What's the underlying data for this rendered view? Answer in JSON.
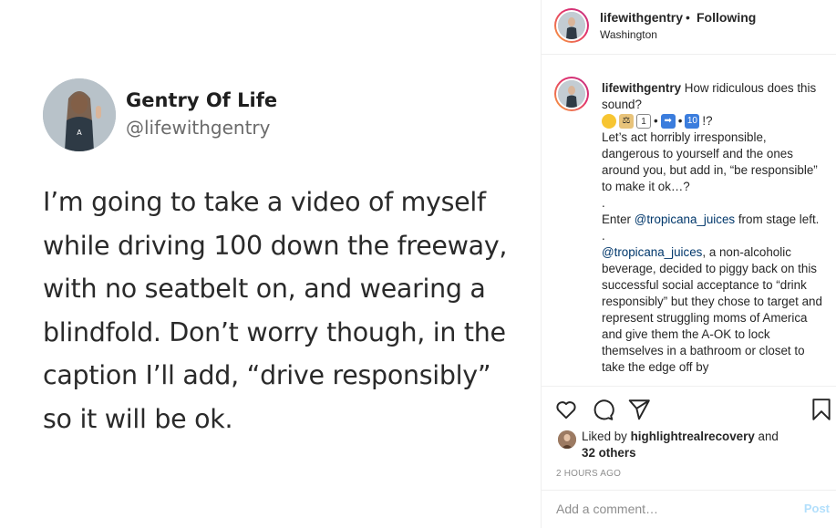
{
  "tweet": {
    "display_name": "Gentry Of Life",
    "handle": "@lifewithgentry",
    "text": "I’m going to take a video of myself while driving 100 down the freeway, with no seatbelt on, and wearing a blindfold. Don’t worry though, in the caption I’ll add, “drive responsibly” so it will be ok."
  },
  "post_header": {
    "username": "lifewithgentry",
    "separator": "•",
    "follow_status": "Following",
    "location": "Washington"
  },
  "caption": {
    "username": "lifewithgentry",
    "line1": "How ridiculous does this sound?",
    "emoji_tail": "!?",
    "para1": "Let’s act horribly irresponsible, dangerous to yourself and the ones around you, but add in, “be responsible” to make it ok…?",
    "dot1": ".",
    "para2_prefix": "Enter ",
    "para2_mention": "@tropicana_juices",
    "para2_suffix": " from stage left.",
    "dot2": ".",
    "para3_mention": "@tropicana_juices",
    "para3_text": ", a non-alcoholic beverage, decided to piggy back on this successful social acceptance to “drink responsibly” but they chose to target and represent struggling moms of America and give them the A-OK to lock themselves in a bathroom or closet to take the edge off by"
  },
  "likes": {
    "prefix": "Liked by ",
    "user": "highlightrealrecovery",
    "and": " and",
    "others": "32 others"
  },
  "timestamp": "2 HOURS AGO",
  "comment_box": {
    "placeholder": "Add a comment…",
    "post_label": "Post"
  },
  "icons": [
    "heart-icon",
    "comment-icon",
    "share-icon",
    "bookmark-icon"
  ],
  "colors": {
    "mention": "#00376b",
    "post_disabled": "#b2dffc",
    "muted": "#8e8e8e"
  }
}
